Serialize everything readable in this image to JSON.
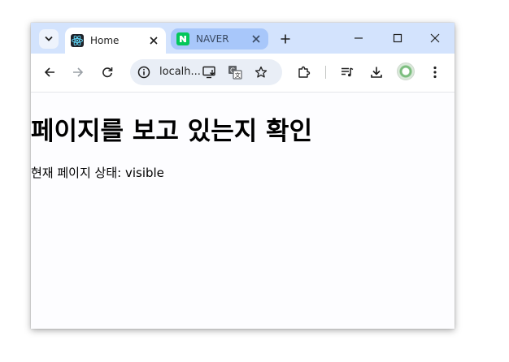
{
  "tabs": [
    {
      "title": "Home",
      "active": true,
      "favicon": "react-icon"
    },
    {
      "title": "NAVER",
      "active": false,
      "favicon": "naver-icon",
      "accent": "#03c75a"
    }
  ],
  "toolbar": {
    "url": "localh...",
    "icons": [
      "back-icon",
      "forward-icon",
      "reload-icon",
      "site-info-icon",
      "install-app-icon",
      "translate-icon",
      "bookmark-star-icon",
      "extensions-icon",
      "media-queue-icon",
      "download-icon",
      "profile-avatar",
      "menu-icon"
    ]
  },
  "page": {
    "heading": "페이지를 보고 있는지 확인",
    "status_text": "현재 페이지 상태: visible"
  },
  "colors": {
    "tabstrip": "#d3e3fd",
    "inactive_tab": "#a8c7fa",
    "omnibox": "#e9eef6"
  }
}
